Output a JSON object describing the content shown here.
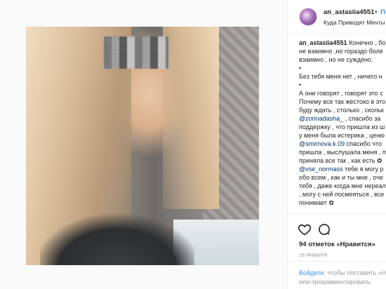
{
  "post": {
    "username": "an_astasiia4551",
    "follow_separator": "•",
    "follow_label": "Подписаться",
    "location": "Куда Приводят Мечты"
  },
  "caption": {
    "lines": [
      "an_astasiia4551 Конечно , бо",
      "не взаимно ,но гораздо боле",
      "взаимно , но не суждено.",
      "•",
      "Без тебя меня нет , ничего н",
      "•",
      "А они говорят , говорят это с",
      "Почему все так жестоко в это",
      "буду ждать , столько , скольк",
      "@zorinadasha_ , спасибо за",
      "поддержку , что пришла из ш",
      "у меня была истерика , ценю",
      "@smirnova.k.09 спасибо что",
      "пришла , выслушала меня , п",
      "приняла все так , как есть ✿",
      "@vse_normass тебе я могу р",
      "обо всем , как и ты мне , оче",
      "тебя , даже когда мне нереал",
      ", могу с ней посмеяться , все",
      "понимает ✿"
    ],
    "username": "an_astasiia4551",
    "first_line_rest": " Конечно , бо",
    "mention_1": "@zorinadasha_",
    "mention_1_rest": " , спасибо за",
    "mention_2": "@smirnova.k.09",
    "mention_2_rest": " спасибо что",
    "mention_3": "@vse_normass",
    "mention_3_rest": " тебе я могу р"
  },
  "actions": {
    "like_icon": "heart-icon",
    "comment_icon": "comment-icon",
    "likes_text": "94 отметок «Нравится»",
    "date": "26 ЯНВАРЯ"
  },
  "login_prompt": {
    "link": "Войдите",
    "text_1": ", чтобы поставить «Нрав",
    "text_2": "или прокомментировать."
  },
  "colors": {
    "link": "#3897f0",
    "text": "#262626",
    "muted": "#999999",
    "mention": "#003569"
  }
}
